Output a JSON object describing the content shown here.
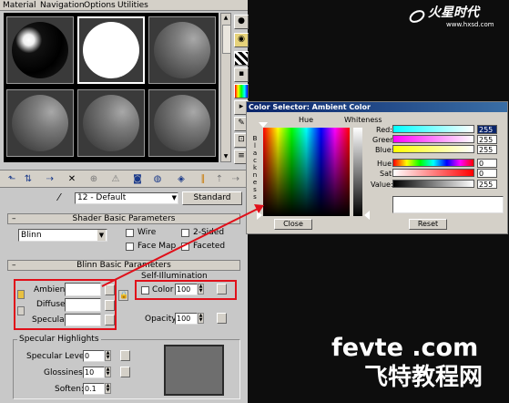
{
  "menu": {
    "material": "Material",
    "navigation": "Navigation",
    "options": "Options",
    "utilities": "Utilities"
  },
  "material_name": "12 - Default",
  "material_type": "Standard",
  "shader_rollout": {
    "title": "Shader Basic Parameters",
    "shader": "Blinn",
    "wire": "Wire",
    "two_sided": "2-Sided",
    "face_map": "Face Map",
    "faceted": "Faceted"
  },
  "blinn_rollout": {
    "title": "Blinn Basic Parameters",
    "ambient": "Ambient:",
    "diffuse": "Diffuse:",
    "specular": "Specular:",
    "self_illum_title": "Self-Illumination",
    "color_label": "Color",
    "color_value": "100",
    "opacity_label": "Opacity:",
    "opacity_value": "100"
  },
  "specular_highlights": {
    "title": "Specular Highlights",
    "level_label": "Specular Level:",
    "level_value": "0",
    "gloss_label": "Glossiness:",
    "gloss_value": "10",
    "soften_label": "Soften:",
    "soften_value": "0.1"
  },
  "color_selector": {
    "title": "Color Selector: Ambient Color",
    "hue_label": "Hue",
    "whiteness_label": "Whiteness",
    "blackness_label": "Blackness",
    "red_label": "Red:",
    "red_value": "255",
    "green_label": "Green:",
    "green_value": "255",
    "blue_label": "Blue:",
    "blue_value": "255",
    "hue2_label": "Hue:",
    "hue_value": "0",
    "sat_label": "Sat:",
    "sat_value": "0",
    "value_label": "Value:",
    "value_value": "255",
    "close_label": "Close",
    "reset_label": "Reset"
  },
  "watermark": {
    "logo_cn": "火星时代",
    "logo_url": "www.hxsd.com",
    "site": "fevte .com",
    "site_cn": "飞特教程网"
  },
  "colors": {
    "annotation_red": "#e0101a",
    "title_bar": "#0a246a"
  }
}
